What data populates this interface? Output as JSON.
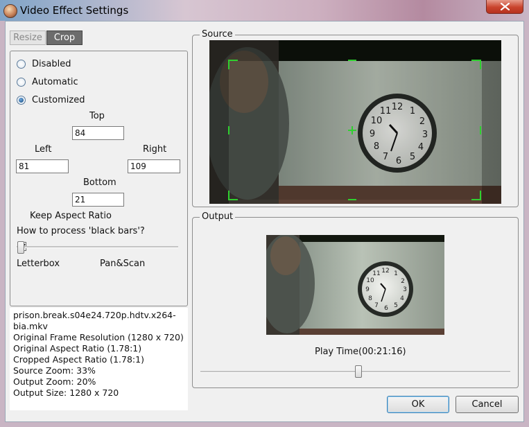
{
  "window": {
    "title": "Video Effect Settings"
  },
  "tabs": [
    {
      "label": "Resize",
      "active": false
    },
    {
      "label": "Crop",
      "active": true
    }
  ],
  "crop": {
    "modes": [
      {
        "label": "Disabled",
        "selected": false
      },
      {
        "label": "Automatic",
        "selected": false
      },
      {
        "label": "Customized",
        "selected": true
      }
    ],
    "top": {
      "label": "Top",
      "value": "84"
    },
    "left": {
      "label": "Left",
      "value": "81"
    },
    "right": {
      "label": "Right",
      "value": "109"
    },
    "bottom": {
      "label": "Bottom",
      "value": "21"
    },
    "keep_aspect": {
      "label": "Keep Aspect Ratio",
      "checked": true
    },
    "black_bars": {
      "question": "How to process 'black bars'?",
      "min_label": "Letterbox",
      "max_label": "Pan&Scan",
      "value_fraction": 0.0
    }
  },
  "info": {
    "lines": [
      "prison.break.s04e24.720p.hdtv.x264-bia.mkv",
      "Original Frame Resolution  (1280 x 720)",
      "Original Aspect Ratio (1.78:1)",
      "Cropped Aspect Ratio (1.78:1)",
      "Source Zoom:  33%",
      "Output Zoom:  20%",
      "Output Size:  1280 x 720"
    ]
  },
  "source": {
    "label": "Source"
  },
  "output": {
    "label": "Output"
  },
  "playback": {
    "label": "Play Time(00:21:16)",
    "position_fraction": 0.51
  },
  "buttons": {
    "ok": "OK",
    "cancel": "Cancel"
  },
  "colors": {
    "accent": "#3c7fb1",
    "crop_marker": "#2fd02f",
    "close_button": "#c9432d"
  }
}
